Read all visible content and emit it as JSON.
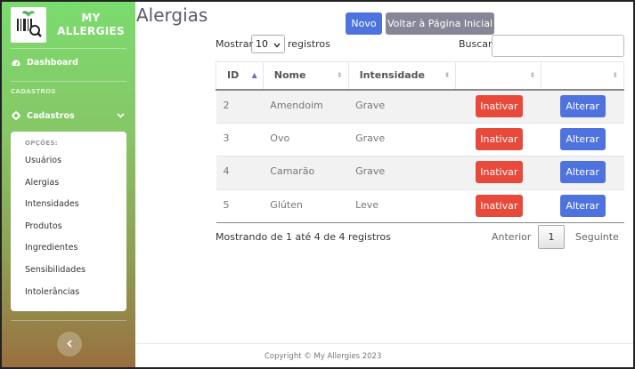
{
  "sidebar": {
    "brand_text": "MY ALLERGIES",
    "dashboard_label": "Dashboard",
    "section_heading": "CADASTROS",
    "cadastros_label": "Cadastros",
    "submenu_heading": "OPÇÕES:",
    "submenu_items": [
      "Usuários",
      "Alergias",
      "Intensidades",
      "Produtos",
      "Ingredientes",
      "Sensibilidades",
      "Intolerâncias"
    ]
  },
  "page": {
    "title": "Alergias",
    "new_button": "Novo",
    "back_button": "Voltar à Página Inicial"
  },
  "table_controls": {
    "show_label": "Mostrar",
    "page_length": "10",
    "records_label": "registros",
    "search_label": "Buscar:",
    "search_value": ""
  },
  "table": {
    "columns": [
      "ID",
      "Nome",
      "Intensidade",
      "",
      ""
    ],
    "rows": [
      {
        "id": "2",
        "nome": "Amendoim",
        "intensidade": "Grave",
        "deactivate": "Inativar",
        "edit": "Alterar"
      },
      {
        "id": "3",
        "nome": "Ovo",
        "intensidade": "Grave",
        "deactivate": "Inativar",
        "edit": "Alterar"
      },
      {
        "id": "4",
        "nome": "Camarão",
        "intensidade": "Grave",
        "deactivate": "Inativar",
        "edit": "Alterar"
      },
      {
        "id": "5",
        "nome": "Glúten",
        "intensidade": "Leve",
        "deactivate": "Inativar",
        "edit": "Alterar"
      }
    ]
  },
  "pagination": {
    "info": "Mostrando de 1 até 4 de 4 registros",
    "previous": "Anterior",
    "current_page": "1",
    "next": "Seguinte"
  },
  "footer": {
    "copyright": "Copyright © My Allergies 2023"
  },
  "colors": {
    "primary": "#4e73df",
    "secondary": "#858796",
    "danger": "#e74a3b",
    "sidebar_top": "#7bdc6e",
    "sidebar_bottom": "#9a6e40"
  }
}
